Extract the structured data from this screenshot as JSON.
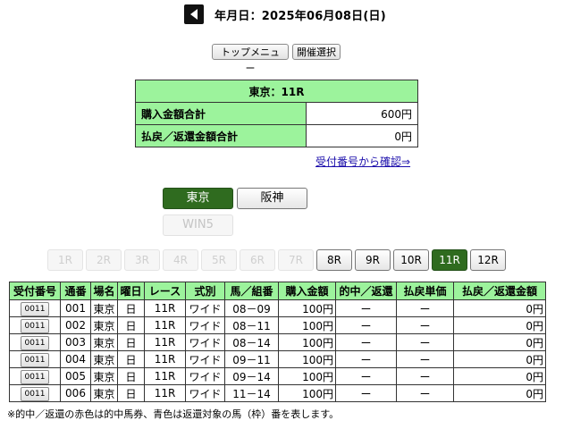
{
  "header": {
    "date_label": "年月日：2025年06月08日(日)"
  },
  "nav": {
    "top_menu": "トップメニュー",
    "venue_select": "開催選択"
  },
  "summary": {
    "title": "東京：11R",
    "purchase_label": "購入金額合計",
    "purchase_value": "600円",
    "refund_label": "払戻／返還金額合計",
    "refund_value": "0円"
  },
  "confirm_link": "受付番号から確認⇒",
  "venues": {
    "tokyo": "東京",
    "hanshin": "阪神",
    "win5": "WIN5"
  },
  "races": [
    "1R",
    "2R",
    "3R",
    "4R",
    "5R",
    "6R",
    "7R",
    "8R",
    "9R",
    "10R",
    "11R",
    "12R"
  ],
  "selected_race": "11R",
  "table": {
    "headers": [
      "受付番号",
      "通番",
      "場名",
      "曜日",
      "レース",
      "式別",
      "馬／組番",
      "購入金額",
      "的中／返還",
      "払戻単価",
      "払戻／返還金額"
    ],
    "rows": [
      [
        "0011",
        "001",
        "東京",
        "日",
        "11R",
        "ワイド",
        "08－09",
        "100円",
        "ー",
        "ー",
        "0円"
      ],
      [
        "0011",
        "002",
        "東京",
        "日",
        "11R",
        "ワイド",
        "08－11",
        "100円",
        "ー",
        "ー",
        "0円"
      ],
      [
        "0011",
        "003",
        "東京",
        "日",
        "11R",
        "ワイド",
        "08－14",
        "100円",
        "ー",
        "ー",
        "0円"
      ],
      [
        "0011",
        "004",
        "東京",
        "日",
        "11R",
        "ワイド",
        "09－11",
        "100円",
        "ー",
        "ー",
        "0円"
      ],
      [
        "0011",
        "005",
        "東京",
        "日",
        "11R",
        "ワイド",
        "09－14",
        "100円",
        "ー",
        "ー",
        "0円"
      ],
      [
        "0011",
        "006",
        "東京",
        "日",
        "11R",
        "ワイド",
        "11－14",
        "100円",
        "ー",
        "ー",
        "0円"
      ]
    ]
  },
  "footnote": "※的中／返還の赤色は的中馬券、青色は返還対象の馬（枠）番を表します。",
  "colors": {
    "header_green": "#9cf39c",
    "selected_green": "#2f6b1f",
    "link_blue": "#1a0dab"
  }
}
